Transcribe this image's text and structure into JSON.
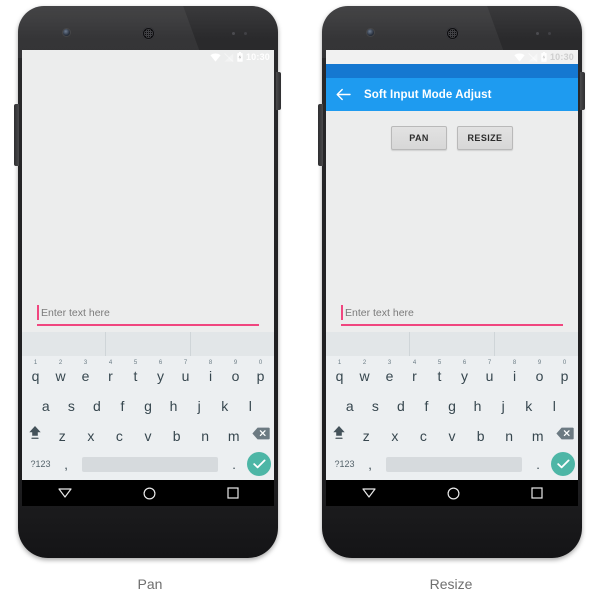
{
  "figure": {
    "panels": [
      {
        "caption": "Pan",
        "mode": "pan",
        "status_bar": {
          "time": "10:30",
          "icons": [
            "wifi-icon",
            "signal-icon",
            "battery-icon"
          ]
        },
        "app_bar_visible": false,
        "buttons_visible": false,
        "edit_text": {
          "placeholder": "Enter text here",
          "value": ""
        }
      },
      {
        "caption": "Resize",
        "mode": "resize",
        "status_bar": {
          "time": "10:30",
          "icons": [
            "wifi-icon",
            "signal-icon",
            "battery-icon"
          ]
        },
        "app_bar_visible": true,
        "app_bar": {
          "title": "Soft Input Mode Adjust",
          "back_icon": "arrow-back-icon"
        },
        "buttons_visible": true,
        "buttons": [
          {
            "label": "PAN"
          },
          {
            "label": "RESIZE"
          }
        ],
        "edit_text": {
          "placeholder": "Enter text here",
          "value": ""
        }
      }
    ]
  },
  "keyboard": {
    "suggestion_strip": [
      "",
      "",
      ""
    ],
    "row1": [
      {
        "key": "q",
        "num": "1"
      },
      {
        "key": "w",
        "num": "2"
      },
      {
        "key": "e",
        "num": "3"
      },
      {
        "key": "r",
        "num": "4"
      },
      {
        "key": "t",
        "num": "5"
      },
      {
        "key": "y",
        "num": "6"
      },
      {
        "key": "u",
        "num": "7"
      },
      {
        "key": "i",
        "num": "8"
      },
      {
        "key": "o",
        "num": "9"
      },
      {
        "key": "p",
        "num": "0"
      }
    ],
    "row2": [
      "a",
      "s",
      "d",
      "f",
      "g",
      "h",
      "j",
      "k",
      "l"
    ],
    "row3": [
      "z",
      "x",
      "c",
      "v",
      "b",
      "n",
      "m"
    ],
    "shift_icon": "shift-icon",
    "backspace_icon": "backspace-icon",
    "symbols_label": "?123",
    "comma_label": ",",
    "period_label": ".",
    "enter_icon": "check-icon"
  },
  "navbar": {
    "back_icon": "back-triangle-icon",
    "home_icon": "home-circle-icon",
    "recents_icon": "recents-square-icon"
  },
  "colors": {
    "accent_blue": "#1e9bf0",
    "status_tint_blue": "#1578d1",
    "edit_underline_pink": "#f0467f",
    "enter_teal": "#4db6a6",
    "screen_bg": "#eceded",
    "keyboard_bg": "#eceff1"
  }
}
